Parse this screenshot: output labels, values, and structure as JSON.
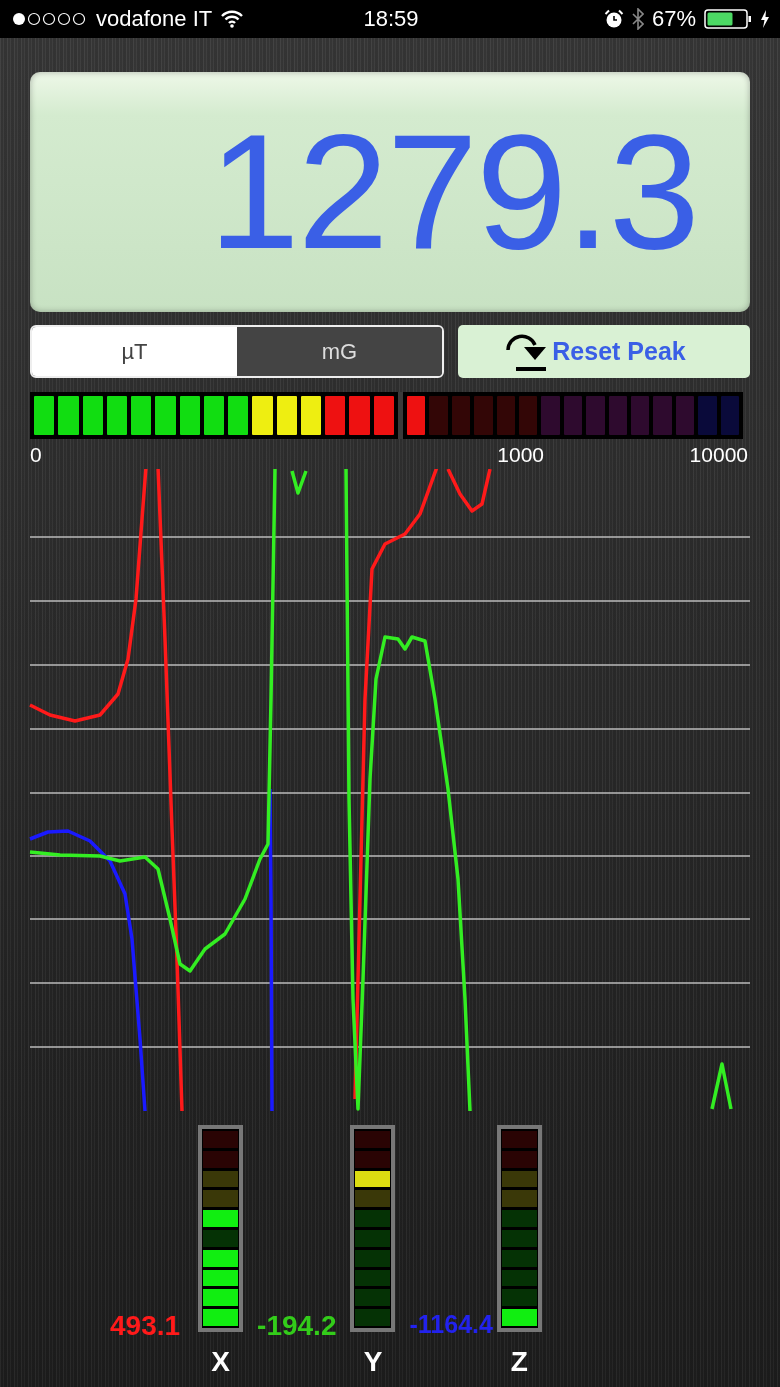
{
  "status_bar": {
    "carrier": "vodafone IT",
    "time": "18:59",
    "battery": "67%"
  },
  "display": {
    "value": "1279.3"
  },
  "units": [
    {
      "label": "µT",
      "selected": true
    },
    {
      "label": "mG",
      "selected": false
    }
  ],
  "reset_button": {
    "label": "Reset Peak"
  },
  "meter": {
    "level": 0.5333,
    "scale": [
      "0",
      "1000",
      "10000"
    ]
  },
  "axes": [
    {
      "value": "493.1",
      "color": "#ff1a1a",
      "label": "X",
      "segments": [
        {
          "lit": false
        },
        {
          "lit": false
        },
        {
          "lit": false
        },
        {
          "lit": false
        },
        {
          "lit": true
        },
        {
          "lit": false
        },
        {
          "lit": true
        },
        {
          "lit": true
        },
        {
          "lit": true
        },
        {
          "lit": true
        }
      ]
    },
    {
      "value": "-194.2",
      "color": "#33cc1a",
      "label": "Y",
      "segments": [
        {
          "lit": false
        },
        {
          "lit": false
        },
        {
          "lit": true
        },
        {
          "lit": false
        },
        {
          "lit": false
        },
        {
          "lit": false
        },
        {
          "lit": false
        },
        {
          "lit": false
        },
        {
          "lit": false
        },
        {
          "lit": false
        }
      ]
    },
    {
      "value": "-1164.4",
      "color": "#2222ee",
      "label": "Z",
      "segments": [
        {
          "lit": false
        },
        {
          "lit": false
        },
        {
          "lit": false
        },
        {
          "lit": false
        },
        {
          "lit": false
        },
        {
          "lit": false
        },
        {
          "lit": false
        },
        {
          "lit": false
        },
        {
          "lit": false
        },
        {
          "lit": true
        }
      ]
    }
  ]
}
